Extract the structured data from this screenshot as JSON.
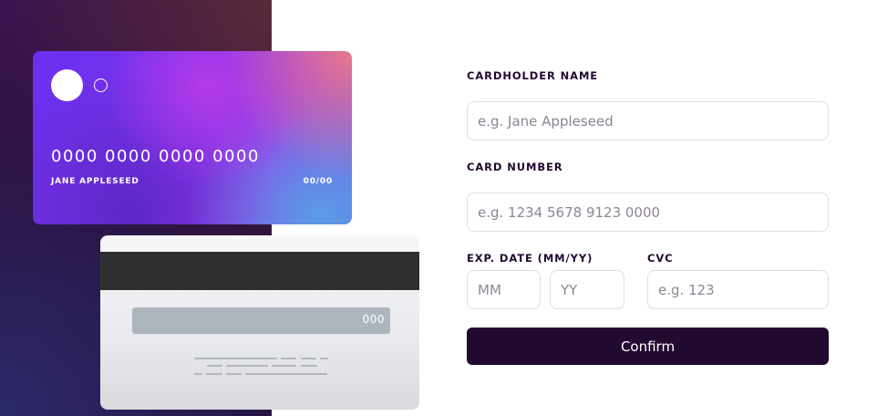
{
  "card_front": {
    "number": "0000 0000 0000 0000",
    "name": "JANE APPLESEED",
    "expiry": "00/00"
  },
  "card_back": {
    "cvc": "000"
  },
  "form": {
    "cardholder_label": "CARDHOLDER NAME",
    "cardholder_placeholder": "e.g. Jane Appleseed",
    "cardholder_value": "",
    "number_label": "CARD NUMBER",
    "number_placeholder": "e.g. 1234 5678 9123 0000",
    "number_value": "",
    "exp_label": "EXP. DATE (MM/YY)",
    "mm_placeholder": "MM",
    "yy_placeholder": "YY",
    "cvc_label": "CVC",
    "cvc_placeholder": "e.g. 123",
    "confirm_label": "Confirm"
  },
  "colors": {
    "dark_violet": "#21092f",
    "input_border": "#dedddf",
    "placeholder": "#8e8593"
  }
}
